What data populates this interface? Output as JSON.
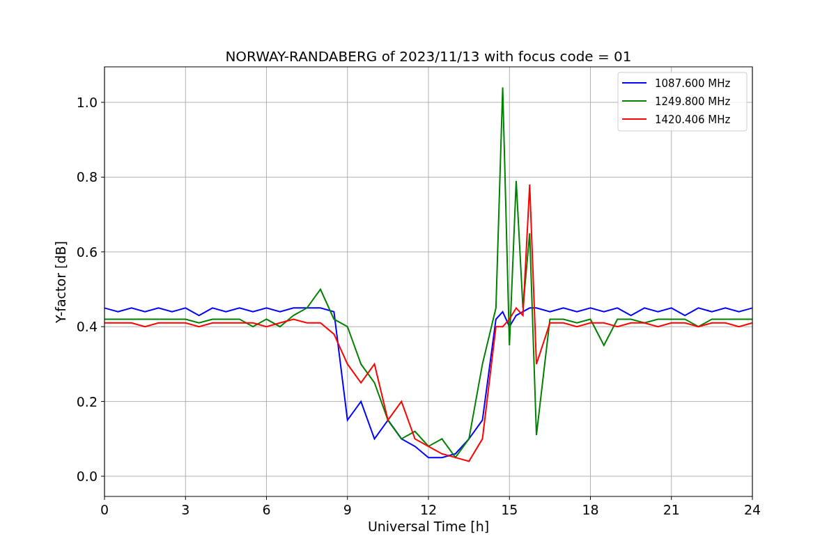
{
  "chart_data": {
    "type": "line",
    "title": "NORWAY-RANDABERG of 2023/11/13 with focus code = 01",
    "xlabel": "Universal Time [h]",
    "ylabel": "Y-factor [dB]",
    "x": [
      0,
      0.5,
      1,
      1.5,
      2,
      2.5,
      3,
      3.5,
      4,
      4.5,
      5,
      5.5,
      6,
      6.5,
      7,
      7.5,
      8,
      8.5,
      9,
      9.5,
      10,
      10.5,
      11,
      11.5,
      12,
      12.5,
      13,
      13.5,
      14,
      14.5,
      14.75,
      15,
      15.25,
      15.5,
      15.75,
      16,
      16.5,
      17,
      17.5,
      18,
      18.5,
      19,
      19.5,
      20,
      20.5,
      21,
      21.5,
      22,
      22.5,
      23,
      23.5,
      24
    ],
    "series": [
      {
        "name": "1087.600 MHz",
        "color": "#0000ff",
        "values": [
          0.45,
          0.44,
          0.45,
          0.44,
          0.45,
          0.44,
          0.45,
          0.43,
          0.45,
          0.44,
          0.45,
          0.44,
          0.45,
          0.44,
          0.45,
          0.45,
          0.45,
          0.44,
          0.15,
          0.2,
          0.1,
          0.15,
          0.1,
          0.08,
          0.05,
          0.05,
          0.06,
          0.1,
          0.15,
          0.42,
          0.44,
          0.4,
          0.43,
          0.44,
          0.45,
          0.45,
          0.44,
          0.45,
          0.44,
          0.45,
          0.44,
          0.45,
          0.43,
          0.45,
          0.44,
          0.45,
          0.43,
          0.45,
          0.44,
          0.45,
          0.44,
          0.45
        ]
      },
      {
        "name": "1249.800 MHz",
        "color": "#008000",
        "values": [
          0.42,
          0.42,
          0.42,
          0.42,
          0.42,
          0.42,
          0.42,
          0.41,
          0.42,
          0.42,
          0.42,
          0.4,
          0.42,
          0.4,
          0.43,
          0.45,
          0.5,
          0.42,
          0.4,
          0.3,
          0.25,
          0.15,
          0.1,
          0.12,
          0.08,
          0.1,
          0.05,
          0.1,
          0.3,
          0.45,
          1.04,
          0.35,
          0.79,
          0.45,
          0.65,
          0.11,
          0.42,
          0.42,
          0.41,
          0.42,
          0.35,
          0.42,
          0.42,
          0.41,
          0.42,
          0.42,
          0.42,
          0.4,
          0.42,
          0.42,
          0.42,
          0.42
        ]
      },
      {
        "name": "1420.406 MHz",
        "color": "#ff0000",
        "values": [
          0.41,
          0.41,
          0.41,
          0.4,
          0.41,
          0.41,
          0.41,
          0.4,
          0.41,
          0.41,
          0.41,
          0.41,
          0.4,
          0.41,
          0.42,
          0.41,
          0.41,
          0.38,
          0.3,
          0.25,
          0.3,
          0.15,
          0.2,
          0.1,
          0.08,
          0.06,
          0.05,
          0.04,
          0.1,
          0.4,
          0.4,
          0.42,
          0.45,
          0.43,
          0.78,
          0.3,
          0.41,
          0.41,
          0.4,
          0.41,
          0.41,
          0.4,
          0.41,
          0.41,
          0.4,
          0.41,
          0.41,
          0.4,
          0.41,
          0.41,
          0.4,
          0.41
        ]
      }
    ],
    "grid": true,
    "legend": true,
    "xlim": [
      0,
      24
    ],
    "ylim": [
      -0.054,
      1.095
    ],
    "xticks": [
      {
        "value": 0,
        "label": "0"
      },
      {
        "value": 3,
        "label": "3"
      },
      {
        "value": 6,
        "label": "6"
      },
      {
        "value": 9,
        "label": "9"
      },
      {
        "value": 12,
        "label": "12"
      },
      {
        "value": 15,
        "label": "15"
      },
      {
        "value": 18,
        "label": "18"
      },
      {
        "value": 21,
        "label": "21"
      },
      {
        "value": 24,
        "label": "24"
      }
    ],
    "yticks": [
      {
        "value": 0,
        "label": "0.0"
      },
      {
        "value": 0.2,
        "label": "0.2"
      },
      {
        "value": 0.4,
        "label": "0.4"
      },
      {
        "value": 0.6,
        "label": "0.6"
      },
      {
        "value": 0.8,
        "label": "0.8"
      },
      {
        "value": 1.0,
        "label": "1.0"
      }
    ]
  }
}
